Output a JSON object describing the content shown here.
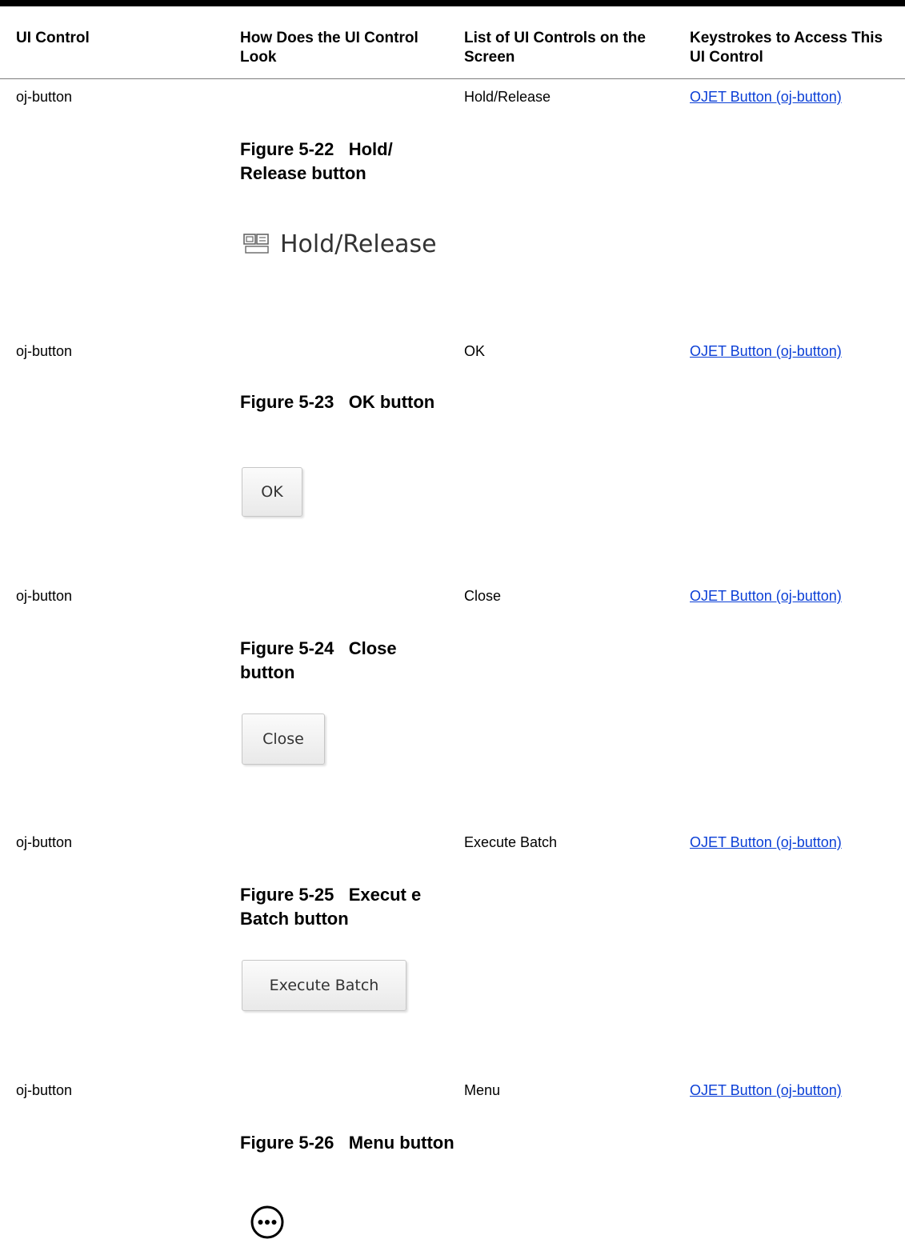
{
  "headers": {
    "col1": "UI Control",
    "col2": "How Does the UI Control Look",
    "col3": "List of UI Controls on the Screen",
    "col4": "Keystrokes to Access This UI Control"
  },
  "rows": [
    {
      "control": "oj-button",
      "figure": "Figure 5-22   Hold/ Release button",
      "image_label": "Hold/Release",
      "screen_label": "Hold/Release",
      "link": "OJET Button (oj-button)"
    },
    {
      "control": "oj-button",
      "figure": "Figure 5-23   OK button",
      "image_label": "OK",
      "screen_label": "OK",
      "link": "OJET Button (oj-button)"
    },
    {
      "control": "oj-button",
      "figure": "Figure 5-24   Close button",
      "image_label": "Close",
      "screen_label": "Close",
      "link": "OJET Button (oj-button)"
    },
    {
      "control": "oj-button",
      "figure": "Figure 5-25   Execut e Batch button",
      "image_label": "Execute Batch",
      "screen_label": "Execute Batch",
      "link": "OJET Button (oj-button)"
    },
    {
      "control": "oj-button",
      "figure": "Figure 5-26   Menu button",
      "image_label": "",
      "screen_label": "Menu",
      "link": "OJET Button (oj-button)"
    }
  ],
  "icons": {
    "hold_release": "hold-release-icon",
    "menu": "ellipsis-circle-icon"
  },
  "colors": {
    "link": "#0b3fd6",
    "rule": "#7d7d7d"
  }
}
